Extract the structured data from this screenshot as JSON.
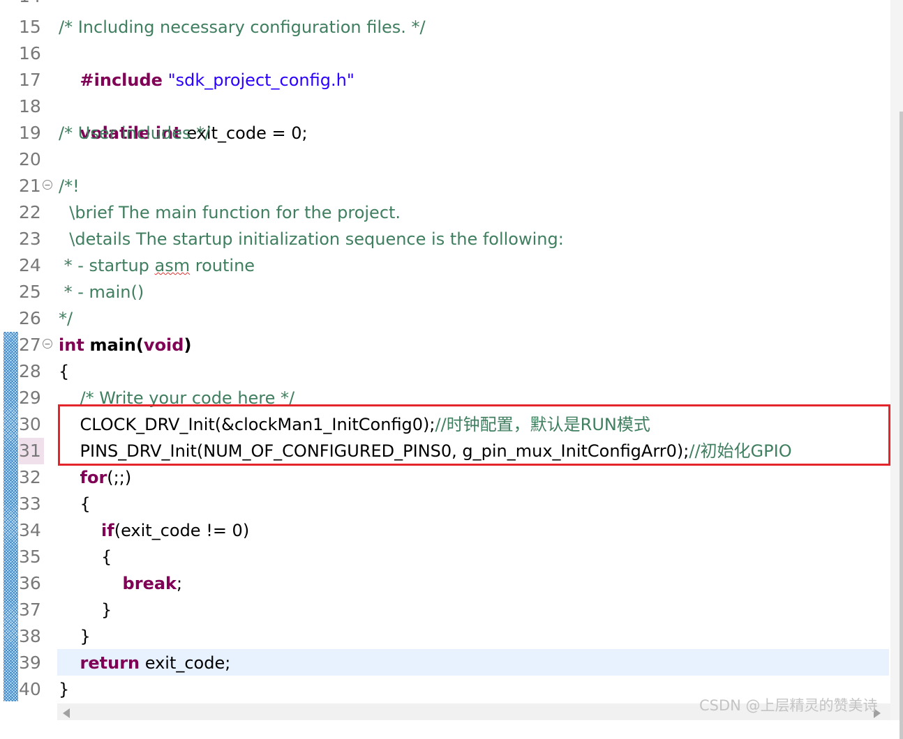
{
  "editor": {
    "partial_top_line": "14",
    "lines": [
      {
        "num": "15"
      },
      {
        "num": "16"
      },
      {
        "num": "17"
      },
      {
        "num": "18"
      },
      {
        "num": "19"
      },
      {
        "num": "20"
      },
      {
        "num": "21"
      },
      {
        "num": "22"
      },
      {
        "num": "23"
      },
      {
        "num": "24"
      },
      {
        "num": "25"
      },
      {
        "num": "26"
      },
      {
        "num": "27"
      },
      {
        "num": "28"
      },
      {
        "num": "29"
      },
      {
        "num": "30"
      },
      {
        "num": "31"
      },
      {
        "num": "32"
      },
      {
        "num": "33"
      },
      {
        "num": "34"
      },
      {
        "num": "35"
      },
      {
        "num": "36"
      },
      {
        "num": "37"
      },
      {
        "num": "38"
      },
      {
        "num": "39"
      },
      {
        "num": "40"
      }
    ],
    "code": {
      "l15": "/* Including necessary configuration files. */",
      "l16_kw": "#include",
      "l16_str": "\"sdk_project_config.h\"",
      "l18_kw1": "volatile",
      "l18_kw2": "int",
      "l18_rest": "exit_code = 0;",
      "l19": "/* User includes */",
      "l21": "/*!",
      "l22": "  \\brief The main function for the project.",
      "l23": "  \\details The startup initialization sequence is the following:",
      "l24_a": " * - startup ",
      "l24_b": "asm",
      "l24_c": " routine",
      "l25": " * - main()",
      "l26": "*/",
      "l27_kw1": "int",
      "l27_mid": "main(",
      "l27_kw2": "void",
      "l27_end": ")",
      "l28": "{",
      "l29": "    /* Write your code here */",
      "l30_code": "    CLOCK_DRV_Init(&clockMan1_InitConfig0);",
      "l30_cm": "//时钟配置，默认是RUN模式",
      "l31_code": "    PINS_DRV_Init(NUM_OF_CONFIGURED_PINS0, g_pin_mux_InitConfigArr0);",
      "l31_cm": "//初始化GPIO",
      "l32_kw": "for",
      "l32_rest": "(;;)",
      "l33": "    {",
      "l34_kw": "if",
      "l34_rest": "(exit_code != 0)",
      "l35": "        {",
      "l36_kw": "break",
      "l36_rest": ";",
      "l37": "        }",
      "l38": "    }",
      "l39_kw": "return",
      "l39_rest": " exit_code;",
      "l40": "}"
    }
  },
  "colors": {
    "keyword": "#7f0055",
    "string": "#2a00ff",
    "comment": "#3f7f5f",
    "highlight_box": "#e3242b",
    "current_line": "#e8f2fe"
  },
  "icons": [
    "collapse-icon",
    "scroll-left-arrow-icon",
    "scroll-right-arrow-icon"
  ],
  "watermark": "CSDN @上层精灵的赞美诗"
}
